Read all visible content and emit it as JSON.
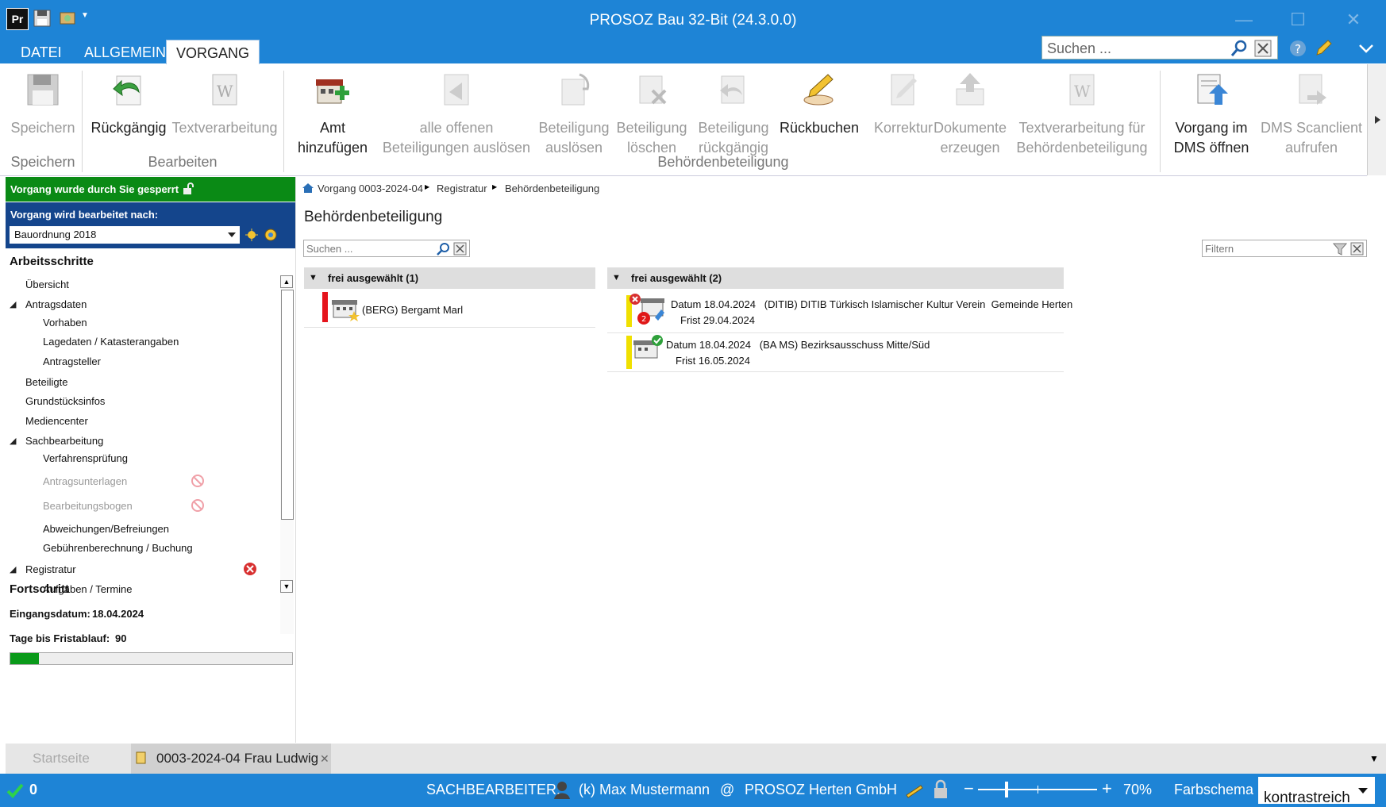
{
  "window": {
    "title": "PROSOZ Bau 32-Bit (24.3.0.0)"
  },
  "tabs": [
    {
      "label": "DATEI"
    },
    {
      "label": "ALLGEMEIN"
    },
    {
      "label": "VORGANG"
    }
  ],
  "ribbon_search": {
    "placeholder": "Suchen ..."
  },
  "ribbon": {
    "buttons": [
      {
        "label1": "Speichern",
        "label2": "",
        "icon": "floppy-disk-icon",
        "enabled": false
      },
      {
        "label1": "Rückgängig",
        "label2": "",
        "icon": "undo-arrow-icon",
        "enabled": true
      },
      {
        "label1": "Textverarbeitung",
        "label2": "",
        "icon": "word-document-icon",
        "enabled": false
      },
      {
        "label1": "Amt",
        "label2": "hinzufügen",
        "icon": "add-office-icon",
        "enabled": true
      },
      {
        "label1": "alle offenen",
        "label2": "Beteiligungen auslösen",
        "icon": "trigger-all-icon",
        "enabled": false
      },
      {
        "label1": "Beteiligung",
        "label2": "auslösen",
        "icon": "trigger-participation-icon",
        "enabled": false
      },
      {
        "label1": "Beteiligung",
        "label2": "löschen",
        "icon": "delete-participation-icon",
        "enabled": false
      },
      {
        "label1": "Beteiligung",
        "label2": "rückgängig",
        "icon": "revert-participation-icon",
        "enabled": false
      },
      {
        "label1": "Rückbuchen",
        "label2": "",
        "icon": "rebook-pen-icon",
        "enabled": true
      },
      {
        "label1": "Korrektur",
        "label2": "",
        "icon": "correction-icon",
        "enabled": false
      },
      {
        "label1": "Dokumente",
        "label2": "erzeugen",
        "icon": "create-documents-icon",
        "enabled": false
      },
      {
        "label1": "Textverarbeitung für",
        "label2": "Behördenbeteiligung",
        "icon": "word-authority-icon",
        "enabled": false
      },
      {
        "label1": "Vorgang im",
        "label2": "DMS öffnen",
        "icon": "dms-open-icon",
        "enabled": true
      },
      {
        "label1": "DMS Scanclient",
        "label2": "aufrufen",
        "icon": "scanclient-icon",
        "enabled": false
      }
    ],
    "groups": [
      {
        "label": "Speichern"
      },
      {
        "label": "Bearbeiten"
      },
      {
        "label": "Behördenbeteiligung"
      }
    ]
  },
  "left_panel": {
    "locked_text": "Vorgang wurde durch Sie gesperrt",
    "edit_label": "Vorgang wird bearbeitet nach:",
    "edit_select": "Bauordnung 2018",
    "steps_title": "Arbeitsschritte",
    "steps": [
      {
        "label": "Übersicht",
        "level": 1,
        "expanded": null,
        "disabled": false,
        "marker": ""
      },
      {
        "label": "Antragsdaten",
        "level": 1,
        "expanded": true,
        "disabled": false,
        "marker": ""
      },
      {
        "label": "Vorhaben",
        "level": 2,
        "expanded": null,
        "disabled": false,
        "marker": ""
      },
      {
        "label": "Lagedaten / Katasterangaben",
        "level": 2,
        "expanded": null,
        "disabled": false,
        "marker": ""
      },
      {
        "label": "Antragsteller",
        "level": 2,
        "expanded": null,
        "disabled": false,
        "marker": ""
      },
      {
        "label": "Beteiligte",
        "level": 1,
        "expanded": null,
        "disabled": false,
        "marker": ""
      },
      {
        "label": "Grundstücksinfos",
        "level": 1,
        "expanded": null,
        "disabled": false,
        "marker": ""
      },
      {
        "label": "Mediencenter",
        "level": 1,
        "expanded": null,
        "disabled": false,
        "marker": ""
      },
      {
        "label": "Sachbearbeitung",
        "level": 1,
        "expanded": true,
        "disabled": false,
        "marker": ""
      },
      {
        "label": "Verfahrensprüfung",
        "level": 2,
        "expanded": null,
        "disabled": false,
        "marker": ""
      },
      {
        "label": "Antragsunterlagen",
        "level": 2,
        "expanded": null,
        "disabled": true,
        "marker": "blocked"
      },
      {
        "label": "Bearbeitungsbogen",
        "level": 2,
        "expanded": null,
        "disabled": true,
        "marker": "blocked"
      },
      {
        "label": "Abweichungen/Befreiungen",
        "level": 2,
        "expanded": null,
        "disabled": false,
        "marker": ""
      },
      {
        "label": "Gebührenberechnung / Buchung",
        "level": 2,
        "expanded": null,
        "disabled": false,
        "marker": ""
      },
      {
        "label": "Registratur",
        "level": 1,
        "expanded": true,
        "disabled": false,
        "marker": "error"
      },
      {
        "label": "Aufgaben / Termine",
        "level": 2,
        "expanded": null,
        "disabled": false,
        "marker": ""
      }
    ],
    "progress_title": "Fortschritt",
    "eingang_label": "Eingangsdatum:",
    "eingang_value": "18.04.2024",
    "frist_label": "Tage bis Fristablauf:",
    "frist_value": "90",
    "progress_fraction": 0.1
  },
  "breadcrumb": [
    {
      "label": "Vorgang 0003-2024-04"
    },
    {
      "label": "Registratur"
    },
    {
      "label": "Behördenbeteiligung"
    }
  ],
  "main": {
    "title": "Behördenbeteiligung",
    "search_placeholder": "Suchen ...",
    "filter_placeholder": "Filtern",
    "left_group": {
      "header": "frei ausgewählt (1)",
      "items": [
        {
          "bar_color": "#e5141c",
          "text": "(BERG) Bergamt Marl"
        }
      ]
    },
    "right_group": {
      "header": "frei ausgewählt (2)",
      "items": [
        {
          "bar_color": "#f0e000",
          "line1": "Datum 18.04.2024   (DITIB) DITIB Türkisch Islamischer Kultur Verein  Gemeinde Herten",
          "line2": "Frist 29.04.2024"
        },
        {
          "bar_color": "#f0e000",
          "line1": "Datum 18.04.2024   (BA MS) Bezirksausschuss Mitte/Süd",
          "line2": "Frist 16.05.2024"
        }
      ]
    }
  },
  "doc_tabs": [
    {
      "label": "Startseite"
    },
    {
      "label": "0003-2024-04 Frau  Ludwig"
    }
  ],
  "status": {
    "count": "0",
    "role_label": "SACHBEARBEITER:",
    "user": "(k) Max Mustermann",
    "at": "@",
    "org": "PROSOZ Herten GmbH",
    "zoom": "70%",
    "scheme_label": "Farbschema",
    "scheme_value": "kontrastreich"
  },
  "colors": {
    "accent": "#1e84d6",
    "locked_green": "#0a8a15",
    "edit_blue": "#14458c"
  }
}
